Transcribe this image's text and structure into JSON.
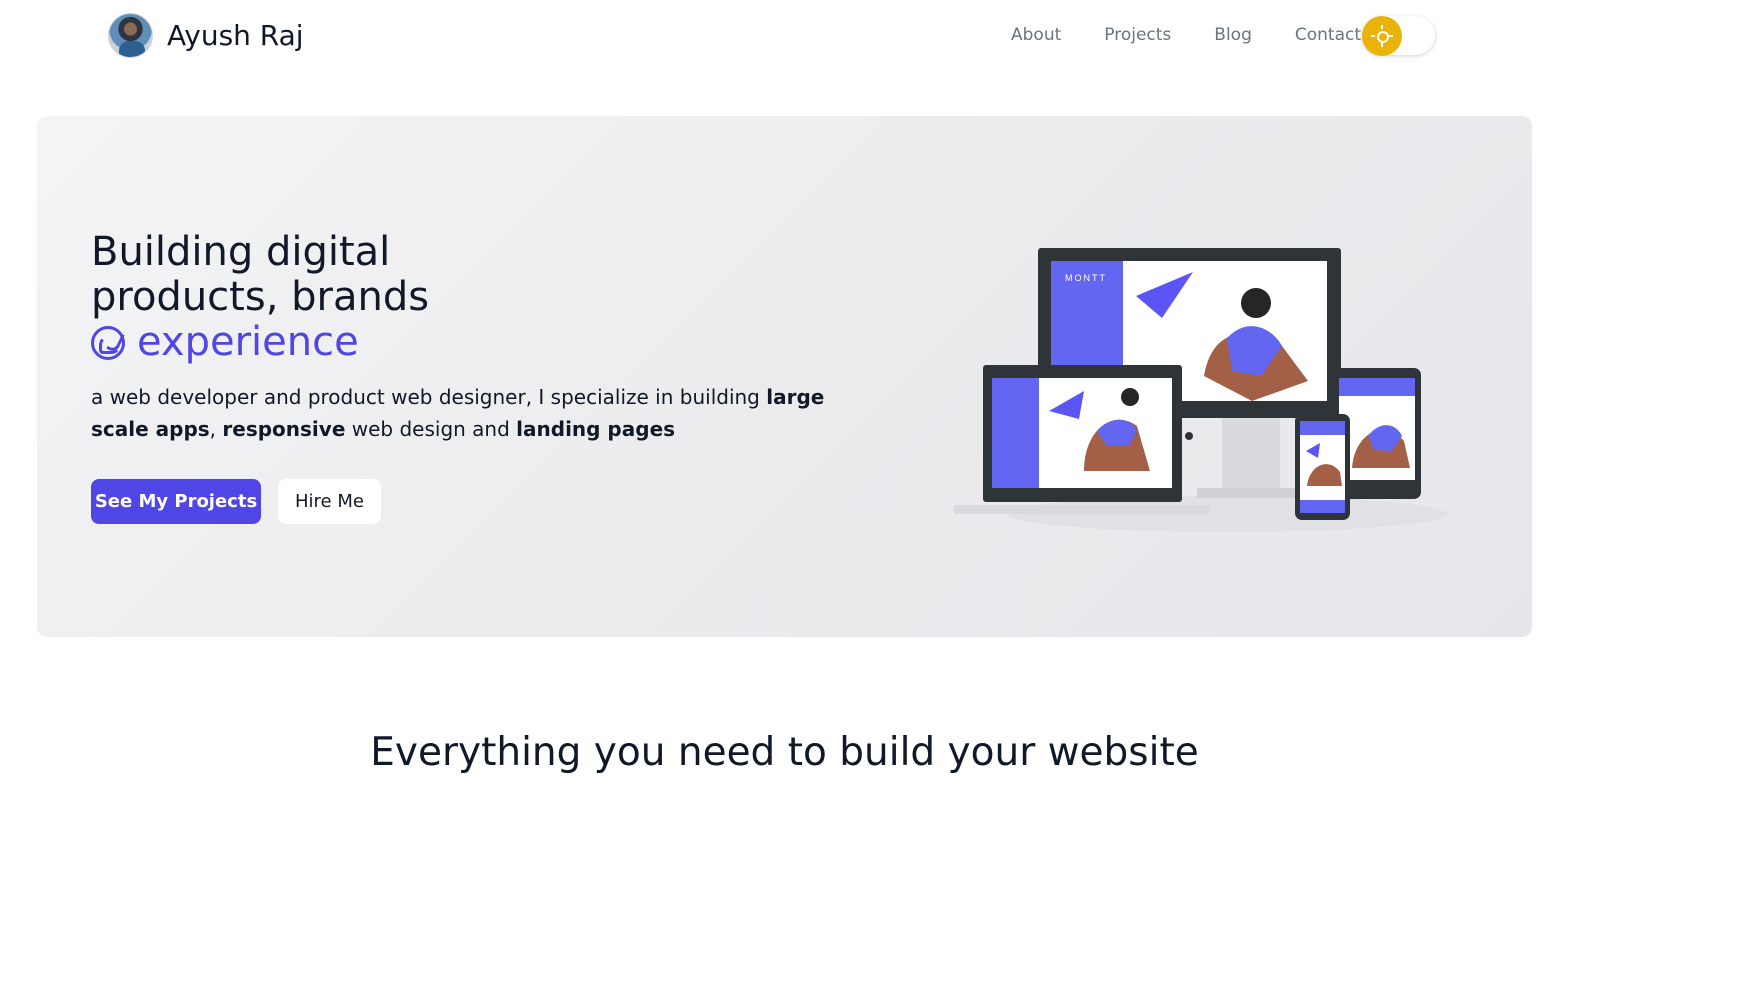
{
  "header": {
    "brand_name": "Ayush Raj",
    "nav": [
      "About",
      "Projects",
      "Blog",
      "Contact"
    ],
    "theme_toggle_icon": "sun-icon"
  },
  "hero": {
    "title_line1": "Building digital",
    "title_line2": "products, brands",
    "title_accent": "experience",
    "description_plain_1": "a web developer and product web designer, I specialize in building ",
    "description_bold_1": "large scale apps",
    "description_plain_2": ", ",
    "description_bold_2": "responsive",
    "description_plain_3": " web design and ",
    "description_bold_3": "landing pages",
    "primary_button": "See My Projects",
    "secondary_button": "Hire Me",
    "illustration_brand": "MONTT"
  },
  "section": {
    "title": "Everything you need to build your website"
  },
  "colors": {
    "accent": "#4f46e5",
    "toggle": "#eab308",
    "hero_bg": "#ececee",
    "text": "#111827",
    "nav_text": "#6b7280"
  }
}
